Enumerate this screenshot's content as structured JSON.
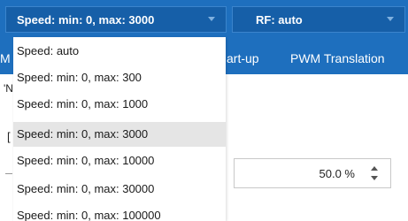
{
  "speed_combo": {
    "value": "Speed: min: 0, max: 3000",
    "options": [
      "Speed: auto",
      "Speed: min: 0, max: 300",
      "Speed: min: 0, max: 1000",
      "Speed: min: 0, max: 3000",
      "Speed: min: 0, max: 10000",
      "Speed: min: 0, max: 30000",
      "Speed: min: 0, max: 100000"
    ],
    "selected_index": 3
  },
  "rf_combo": {
    "value": "RF: auto"
  },
  "tabs": {
    "left_fragment": "M",
    "startup": "art-up",
    "pwm": "PWM Translation"
  },
  "background_fragments": {
    "frag1": "'N",
    "frag2": "["
  },
  "spinbox": {
    "value": "50.0 %"
  },
  "colors": {
    "toolbar": "#1e6fbe",
    "combo": "#165fa8",
    "selected_item": "#e5e5e5"
  }
}
